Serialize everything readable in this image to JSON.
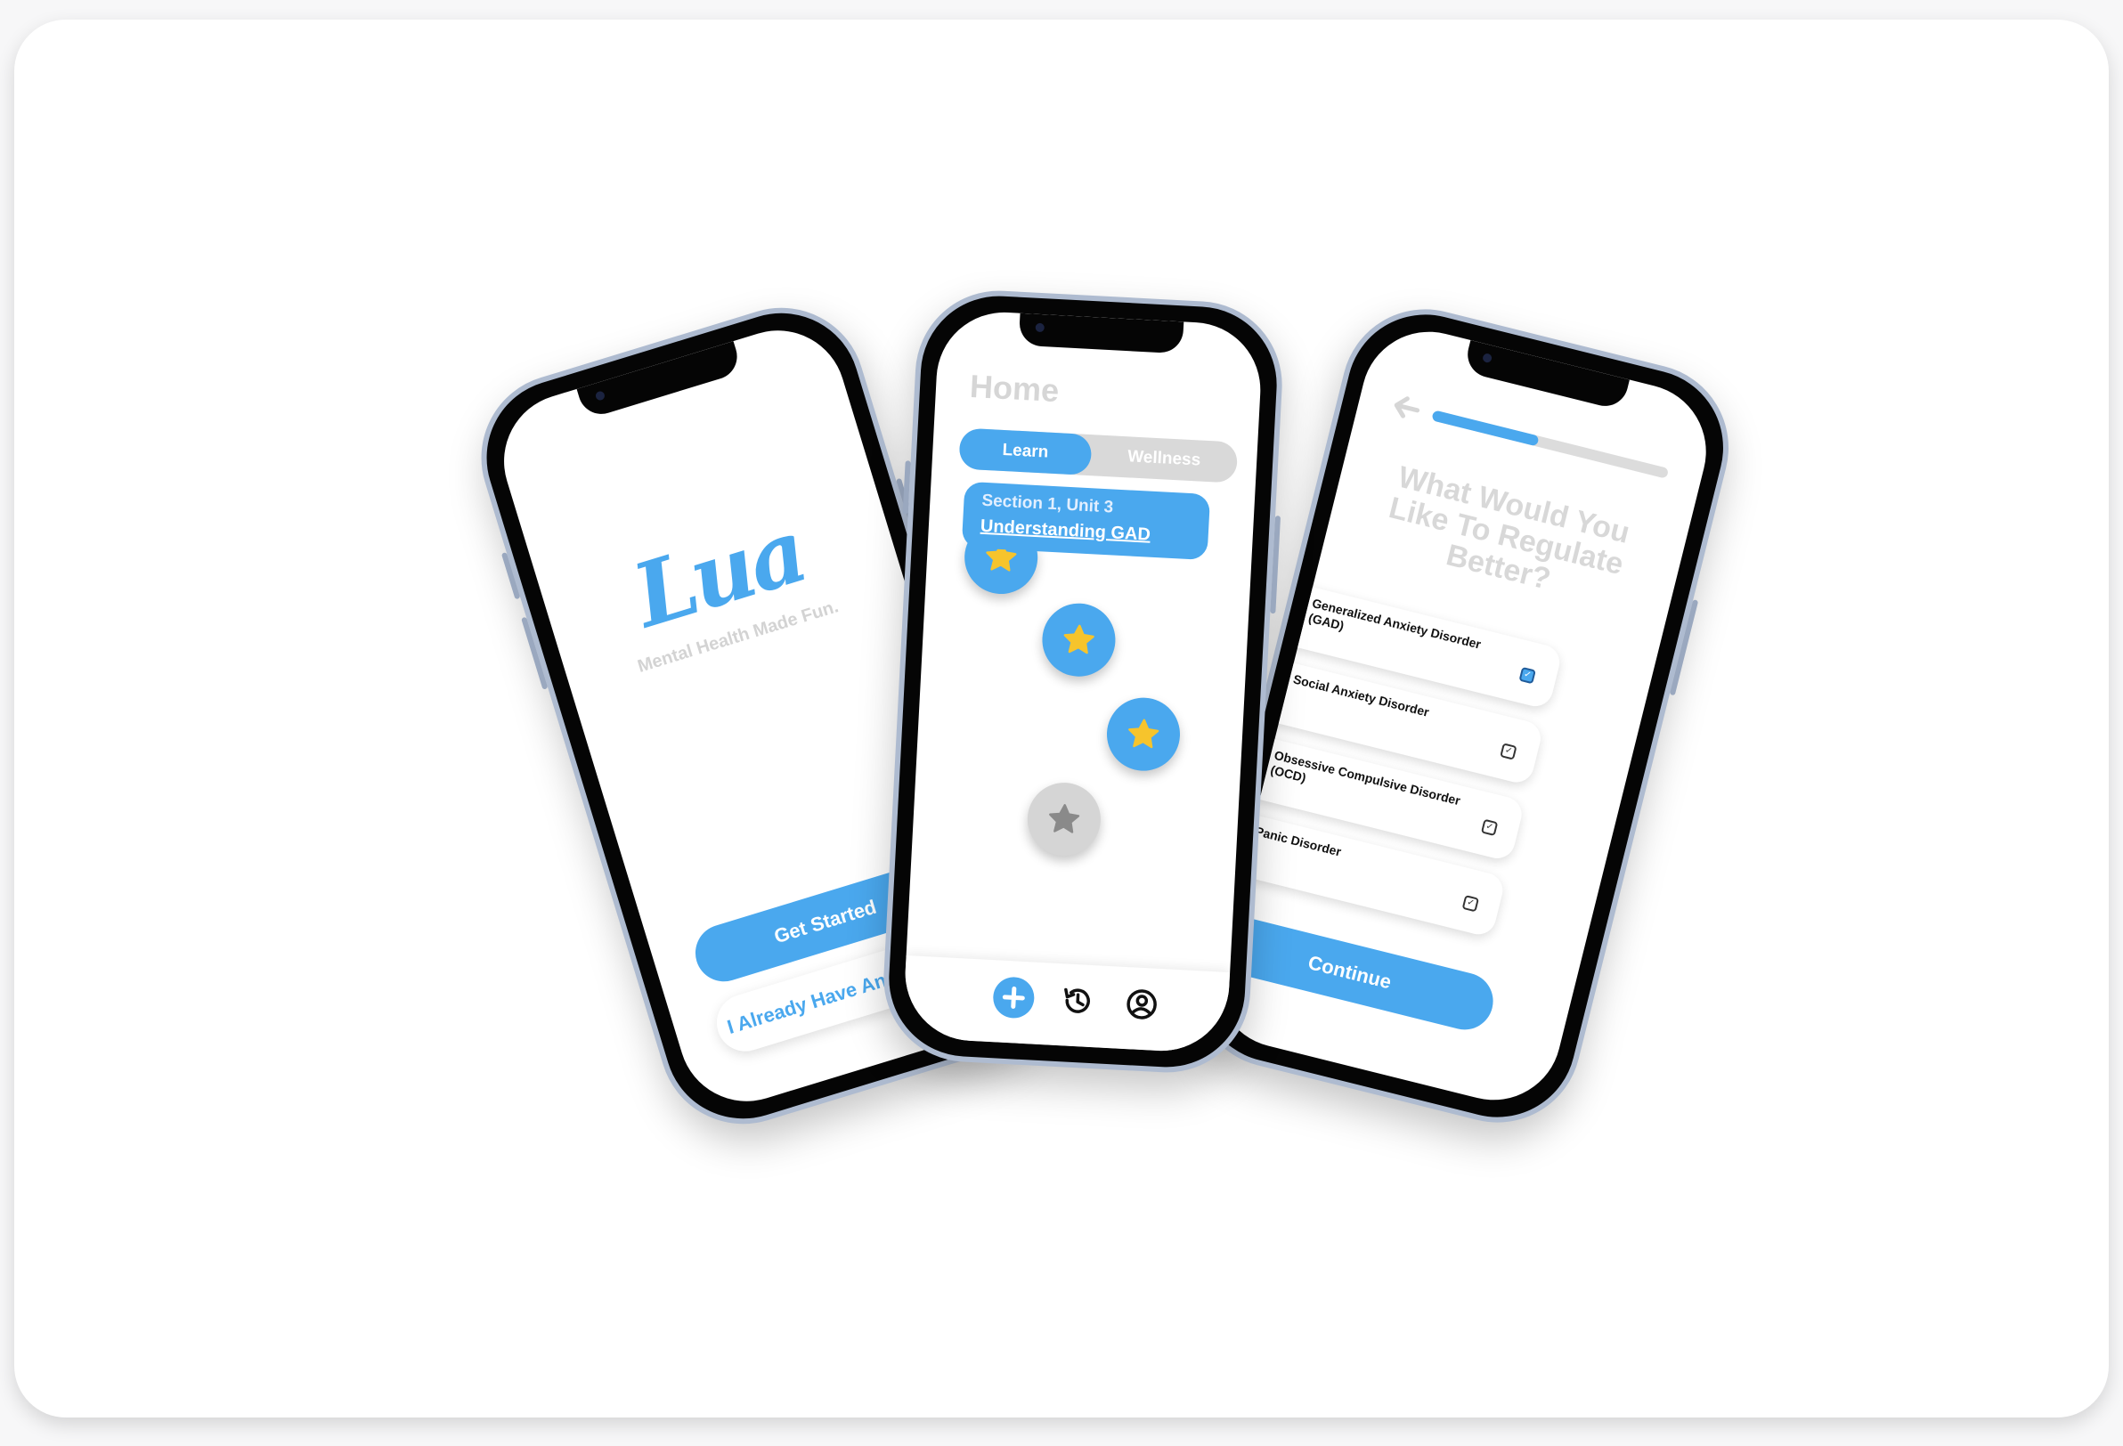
{
  "welcome_screen": {
    "logo": "Lua",
    "tagline": "Mental Health Made Fun.",
    "get_started_label": "Get Started",
    "existing_account_label": "I Already Have An Account"
  },
  "home_screen": {
    "title": "Home",
    "tabs": [
      "Learn",
      "Wellness"
    ],
    "selected_tab": "Learn",
    "unit_card": {
      "section": "Section 1, Unit 3",
      "title": "Understanding GAD"
    },
    "lesson_nodes": [
      {
        "status": "complete",
        "icon": "star-icon"
      },
      {
        "status": "complete",
        "icon": "star-icon"
      },
      {
        "status": "complete",
        "icon": "star-icon"
      },
      {
        "status": "locked",
        "icon": "star-icon"
      }
    ],
    "tab_bar": [
      "add-icon",
      "history-icon",
      "profile-icon"
    ]
  },
  "onboarding_screen": {
    "progress_fraction": 0.45,
    "question": "What Would You Like To Regulate Better?",
    "options": [
      {
        "label": "Generalized Anxiety Disorder (GAD)",
        "checked": true
      },
      {
        "label": "Social Anxiety Disorder",
        "checked": false
      },
      {
        "label": "Obsessive Compulsive Disorder (OCD)",
        "checked": false
      },
      {
        "label": "Panic Disorder",
        "checked": false
      }
    ],
    "continue_label": "Continue"
  },
  "colors": {
    "accent": "#4aa8ee",
    "star": "#f6c42c",
    "locked_star": "#8a8a8a",
    "muted_text": "#d6d6d6"
  }
}
